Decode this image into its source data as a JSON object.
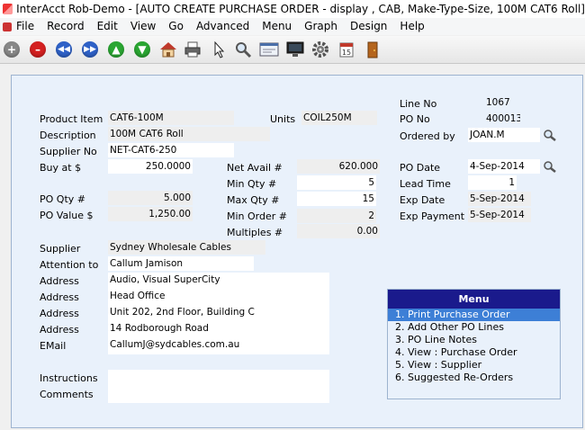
{
  "window": {
    "title": "InterAcct Rob-Demo - [AUTO CREATE PURCHASE ORDER - display , CAB, Make-Type-Size, 100M CAT6 Roll]"
  },
  "menubar": {
    "items": [
      "File",
      "Record",
      "Edit",
      "View",
      "Go",
      "Advanced",
      "Menu",
      "Graph",
      "Design",
      "Help"
    ]
  },
  "toolbar": {
    "icons": [
      "add-icon",
      "delete-icon",
      "first-record-icon",
      "last-record-icon",
      "up-arrow-icon",
      "down-arrow-icon",
      "home-icon",
      "printer-icon",
      "pointer-icon",
      "search-icon",
      "form-icon",
      "monitor-icon",
      "gear-icon",
      "calendar-icon",
      "door-exit-icon"
    ],
    "calendar_text": "15"
  },
  "form": {
    "labels": {
      "line_no": "Line No",
      "po_no": "PO No",
      "ordered_by": "Ordered by",
      "product_item": "Product Item",
      "units": "Units",
      "description": "Description",
      "supplier_no": "Supplier No",
      "buy_at": "Buy at $",
      "net_avail": "Net Avail #",
      "po_date": "PO Date",
      "min_qty": "Min Qty #",
      "lead_time": "Lead Time",
      "po_qty": "PO Qty #",
      "max_qty": "Max Qty #",
      "exp_date": "Exp Date",
      "po_value": "PO Value $",
      "min_order": "Min Order #",
      "exp_payment": "Exp Payment",
      "multiples": "Multiples #",
      "supplier": "Supplier",
      "attention_to": "Attention to",
      "address": "Address",
      "email": "EMail",
      "instructions": "Instructions",
      "comments": "Comments"
    },
    "values": {
      "line_no": "1067",
      "po_no": "400013",
      "ordered_by": "JOAN.M",
      "product_item": "CAT6-100M",
      "units": "COIL250M",
      "description": "100M CAT6 Roll",
      "supplier_no": "NET-CAT6-250",
      "buy_at": "250.0000",
      "net_avail": "620.000",
      "po_date": "4-Sep-2014",
      "min_qty": "5",
      "lead_time": "1",
      "po_qty": "5.000",
      "max_qty": "15",
      "exp_date": "5-Sep-2014",
      "po_value": "1,250.00",
      "min_order": "2",
      "exp_payment": "5-Sep-2014",
      "multiples": "0.00",
      "supplier": "Sydney Wholesale Cables",
      "attention_to": "Callum Jamison",
      "address1": "Audio, Visual SuperCity",
      "address2": "Head Office",
      "address3": "Unit 202, 2nd Floor, Building C",
      "address4": "14 Rodborough Road",
      "email": "CallumJ@sydcables.com.au",
      "instructions": "",
      "comments": ""
    }
  },
  "menu": {
    "title": "Menu",
    "items": [
      "1. Print Purchase Order",
      "2. Add Other PO Lines",
      "3. PO Line Notes",
      "4. View : Purchase Order",
      "5. View : Supplier",
      "6. Suggested Re-Orders"
    ],
    "selected_index": 0
  },
  "colors": {
    "menu_header": "#1a1a8c",
    "menu_selected": "#3d7fd6",
    "panel_bg": "#e9f1fb"
  }
}
